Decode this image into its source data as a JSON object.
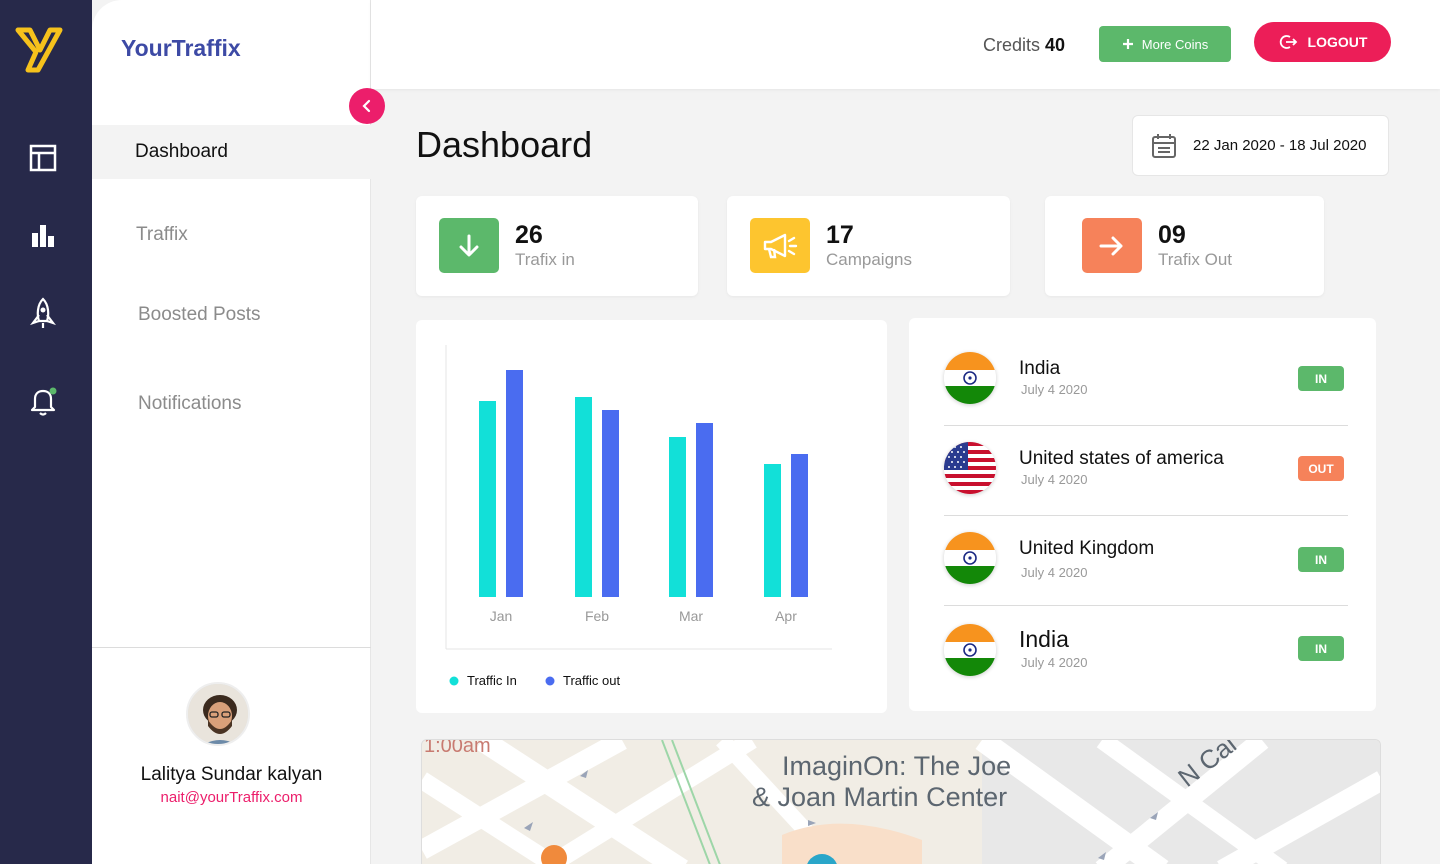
{
  "app": {
    "brand": "YourTraffix"
  },
  "sidebar": {
    "items": [
      {
        "label": "Dashboard",
        "active": true
      },
      {
        "label": "Traffix",
        "active": false
      },
      {
        "label": "Boosted Posts",
        "active": false
      },
      {
        "label": "Notifications",
        "active": false
      }
    ],
    "user": {
      "name": "Lalitya Sundar kalyan",
      "email": "nait@yourTraffix.com"
    }
  },
  "header": {
    "credits_label": "Credits",
    "credits_value": "40",
    "more_coins_label": "More Coins",
    "logout_label": "LOGOUT"
  },
  "main": {
    "title": "Dashboard",
    "date_range": "22 Jan 2020 - 18 Jul 2020",
    "stats": [
      {
        "value": "26",
        "label": "Trafix in",
        "color": "#5cb86b",
        "icon": "arrow-down-icon"
      },
      {
        "value": "17",
        "label": "Campaigns",
        "color": "#fdc52f",
        "icon": "megaphone-icon"
      },
      {
        "value": "09",
        "label": "Trafix Out",
        "color": "#f6825a",
        "icon": "arrow-right-icon"
      }
    ],
    "countries": [
      {
        "name": "India",
        "date": "July 4 2020",
        "status": "IN",
        "flag": "india-flag-icon"
      },
      {
        "name": "United states of america",
        "date": "July 4 2020",
        "status": "OUT",
        "flag": "usa-flag-icon"
      },
      {
        "name": "United Kingdom",
        "date": "July 4 2020",
        "status": "IN",
        "flag": "india-flag-icon"
      },
      {
        "name": "India",
        "date": "July 4 2020",
        "status": "IN",
        "flag": "india-flag-icon"
      }
    ]
  },
  "map": {
    "labels": [
      "1:00am",
      "ImaginOn: The Joe",
      "& Joan Martin Center",
      "N Cal"
    ]
  },
  "colors": {
    "rail": "#27294a",
    "brand": "#3d4aa5",
    "accent_pink": "#ec1e6b",
    "in_green": "#5cb86b",
    "out_orange": "#f6825a",
    "traffic_in": "#12e0d8",
    "traffic_out": "#4a6cf0"
  },
  "chart_data": {
    "type": "bar",
    "categories": [
      "Jan",
      "Feb",
      "Mar",
      "Apr"
    ],
    "series": [
      {
        "name": "Traffic In",
        "values": [
          196,
          200,
          160,
          133
        ]
      },
      {
        "name": "Traffic out",
        "values": [
          227,
          187,
          174,
          143
        ]
      }
    ],
    "ylim": [
      0,
      250
    ],
    "legend": "bottom-left",
    "grid": false
  }
}
